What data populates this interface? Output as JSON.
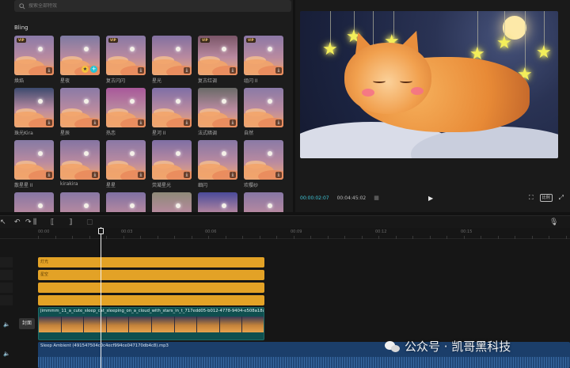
{
  "search": {
    "placeholder": "搜索全部特效"
  },
  "effects_panel": {
    "category": "Bling",
    "items": [
      {
        "label": "焕焰",
        "vip": true,
        "tint": "#8a7aa8"
      },
      {
        "label": "星夜",
        "vip": false,
        "tint": "#7e7aa2",
        "favorite": true,
        "add": true
      },
      {
        "label": "复古闪闪",
        "vip": true,
        "tint": "#8878a4"
      },
      {
        "label": "星光",
        "vip": false,
        "tint": "#8270a0"
      },
      {
        "label": "复古红调",
        "vip": true,
        "tint": "#7a5568"
      },
      {
        "label": "组闪 II",
        "vip": true,
        "tint": "#8c78a6"
      },
      {
        "label": "珠光Kira",
        "vip": false,
        "tint": "#3c4a6e"
      },
      {
        "label": "星辰",
        "vip": false,
        "tint": "#8a7aa6"
      },
      {
        "label": "热恋",
        "vip": false,
        "tint": "#a8589a"
      },
      {
        "label": "星河 II",
        "vip": false,
        "tint": "#7e6ea6"
      },
      {
        "label": "法式暗调",
        "vip": false,
        "tint": "#6a6a68"
      },
      {
        "label": "自然",
        "vip": false,
        "tint": "#8a7aa6"
      },
      {
        "label": "散星星 II",
        "vip": false,
        "tint": "#857aa4"
      },
      {
        "label": "kirakira",
        "vip": false,
        "tint": "#8474a2"
      },
      {
        "label": "星星",
        "vip": false,
        "tint": "#8a78a6"
      },
      {
        "label": "荧凝星光",
        "vip": false,
        "tint": "#7e6ea4"
      },
      {
        "label": "细闪",
        "vip": false,
        "tint": "#8676a4"
      },
      {
        "label": "欢樱纱",
        "vip": false,
        "tint": "#8a7aa6"
      },
      {
        "label": "",
        "vip": false,
        "tint": "#8676a4"
      },
      {
        "label": "",
        "vip": false,
        "tint": "#8878a4"
      },
      {
        "label": "",
        "vip": false,
        "tint": "#7e70a2"
      },
      {
        "label": "",
        "vip": false,
        "tint": "#8e8a78"
      },
      {
        "label": "",
        "vip": false,
        "tint": "#4a4a9a"
      },
      {
        "label": "",
        "vip": false,
        "tint": "#8676a4"
      }
    ],
    "vip_badge": "VIP"
  },
  "preview": {
    "current_time": "00:00:02:07",
    "total_time": "00:04:45:02",
    "ratio_label": "比例"
  },
  "timeline": {
    "ruler_ticks": [
      "00:00",
      "00:03",
      "00:06",
      "00:09",
      "00:12",
      "00:15"
    ],
    "effect_bars": [
      {
        "label": "灯光"
      },
      {
        "label": "星空"
      },
      {
        "label": ""
      },
      {
        "label": ""
      }
    ],
    "cover_label": "封面",
    "video_clip_title": "Jimmmm_11_a_cute_sleep_cat_sleeping_on_a_cloud_with_stars_in_t_717edd05-b012-4778-9404-e508a18a",
    "audio_clip_title": "Sleep Ambient (491547504c0c4ecf994ce047170db4c8).mp3"
  },
  "watermark": {
    "text": "公众号 · 凯哥黑科技"
  },
  "colors": {
    "accent_cyan": "#3fc6d8",
    "effect_bar": "#e3a226",
    "video_track": "#0f4f4f",
    "audio_track": "#1b3e6a"
  }
}
